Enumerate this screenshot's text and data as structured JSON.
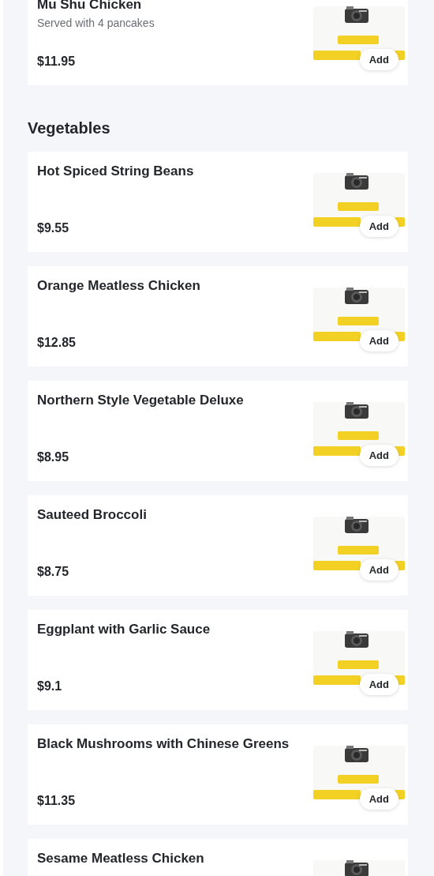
{
  "sections": [
    {
      "items": [
        {
          "name": "Mu Shu Chicken",
          "description": "Served with 4 pancakes",
          "price": "$11.95",
          "button": "Add"
        }
      ]
    },
    {
      "heading": "Vegetables",
      "items": [
        {
          "name": "Hot Spiced String Beans",
          "price": "$9.55",
          "button": "Add"
        },
        {
          "name": "Orange Meatless Chicken",
          "price": "$12.85",
          "button": "Add"
        },
        {
          "name": "Northern Style Vegetable Deluxe",
          "price": "$8.95",
          "button": "Add"
        },
        {
          "name": "Sauteed Broccoli",
          "price": "$8.75",
          "button": "Add"
        },
        {
          "name": "Eggplant with Garlic Sauce",
          "price": "$9.1",
          "button": "Add"
        },
        {
          "name": "Black Mushrooms with Chinese Greens",
          "price": "$11.35",
          "button": "Add"
        },
        {
          "name": "Sesame Meatless Chicken"
        }
      ]
    }
  ]
}
